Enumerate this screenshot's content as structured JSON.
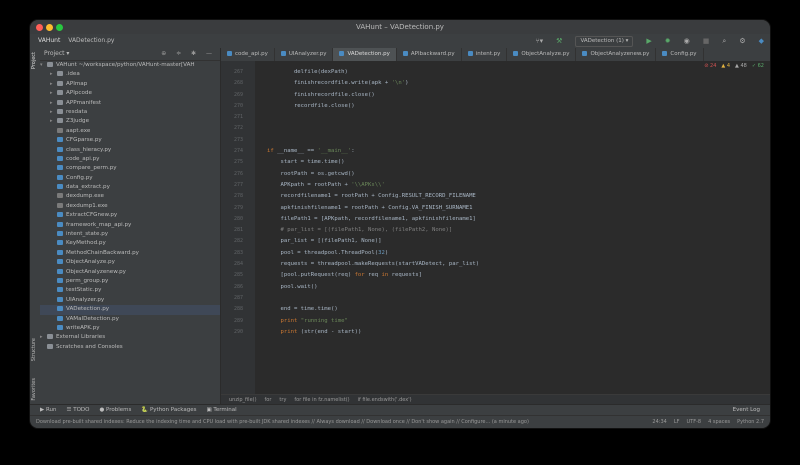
{
  "window": {
    "title": "VAHunt – VADetection.py",
    "colors": {
      "close": "#ff5f57",
      "minimize": "#febc2e",
      "maximize": "#28c840",
      "run_green": "#59a869"
    }
  },
  "navbar": {
    "project": "VAHunt",
    "file": "VADetection.py",
    "run_config": "VADetection (1) ▾",
    "icons": [
      "hammer-icon",
      "play-icon",
      "debug-icon",
      "coverage-icon",
      "stop-icon",
      "search-icon",
      "settings-icon"
    ]
  },
  "left_strip": {
    "project_tab": "Project",
    "structure_tab": "Structure",
    "favorites_tab": "Favorites"
  },
  "project_panel": {
    "header": "Project ▾",
    "root": "VAHunt ~/workspace/python/VAHunt-master[VAH",
    "items": [
      {
        "label": ".idea",
        "type": "folder",
        "indent": 1,
        "arrow": true
      },
      {
        "label": "APImap",
        "type": "folder",
        "indent": 1,
        "arrow": true
      },
      {
        "label": "APIpcode",
        "type": "folder",
        "indent": 1,
        "arrow": true
      },
      {
        "label": "APPmanifest",
        "type": "folder",
        "indent": 1,
        "arrow": true
      },
      {
        "label": "resdata",
        "type": "folder",
        "indent": 1,
        "arrow": true
      },
      {
        "label": "Z3judge",
        "type": "folder",
        "indent": 1,
        "arrow": true
      },
      {
        "label": "aapt.exe",
        "type": "exe",
        "indent": 1,
        "arrow": false
      },
      {
        "label": "CFGparse.py",
        "type": "py",
        "indent": 1,
        "arrow": false
      },
      {
        "label": "class_hieracy.py",
        "type": "py",
        "indent": 1,
        "arrow": false
      },
      {
        "label": "code_api.py",
        "type": "py",
        "indent": 1,
        "arrow": false
      },
      {
        "label": "compare_perm.py",
        "type": "py",
        "indent": 1,
        "arrow": false
      },
      {
        "label": "Config.py",
        "type": "py",
        "indent": 1,
        "arrow": false
      },
      {
        "label": "data_extract.py",
        "type": "py",
        "indent": 1,
        "arrow": false
      },
      {
        "label": "dexdump.exe",
        "type": "exe",
        "indent": 1,
        "arrow": false
      },
      {
        "label": "dexdump1.exe",
        "type": "exe",
        "indent": 1,
        "arrow": false
      },
      {
        "label": "ExtractCFGnew.py",
        "type": "py",
        "indent": 1,
        "arrow": false
      },
      {
        "label": "framework_map_api.py",
        "type": "py",
        "indent": 1,
        "arrow": false
      },
      {
        "label": "intent_state.py",
        "type": "py",
        "indent": 1,
        "arrow": false
      },
      {
        "label": "KeyMethod.py",
        "type": "py",
        "indent": 1,
        "arrow": false
      },
      {
        "label": "MethodChainBackward.py",
        "type": "py",
        "indent": 1,
        "arrow": false
      },
      {
        "label": "ObjectAnalyze.py",
        "type": "py",
        "indent": 1,
        "arrow": false
      },
      {
        "label": "ObjectAnalyzenew.py",
        "type": "py",
        "indent": 1,
        "arrow": false
      },
      {
        "label": "perm_group.py",
        "type": "py",
        "indent": 1,
        "arrow": false
      },
      {
        "label": "testStatic.py",
        "type": "py",
        "indent": 1,
        "arrow": false
      },
      {
        "label": "UIAnalyzer.py",
        "type": "py",
        "indent": 1,
        "arrow": false
      },
      {
        "label": "VADetection.py",
        "type": "py",
        "indent": 1,
        "arrow": false
      },
      {
        "label": "VAMalDetection.py",
        "type": "py",
        "indent": 1,
        "arrow": false
      },
      {
        "label": "writeAPK.py",
        "type": "py",
        "indent": 1,
        "arrow": false
      },
      {
        "label": "External Libraries",
        "type": "folder",
        "indent": 0,
        "arrow": true
      },
      {
        "label": "Scratches and Consoles",
        "type": "folder",
        "indent": 0,
        "arrow": false
      }
    ]
  },
  "tabs": [
    {
      "label": "code_api.py",
      "active": false
    },
    {
      "label": "UIAnalyzer.py",
      "active": false
    },
    {
      "label": "VADetection.py",
      "active": true
    },
    {
      "label": "APIbackward.py",
      "active": false
    },
    {
      "label": "intent.py",
      "active": false
    },
    {
      "label": "ObjectAnalyze.py",
      "active": false
    },
    {
      "label": "ObjectAnalyzenew.py",
      "active": false
    },
    {
      "label": "Config.py",
      "active": false
    }
  ],
  "inspections": {
    "errors": "24",
    "warnings": "4",
    "weak": "48",
    "typos": "62"
  },
  "code_lines": [
    {
      "n": "267",
      "html": "        delfile(dexPath)"
    },
    {
      "n": "268",
      "html": "        finishrecordfile.write(apk + <span class='str'>'\\n'</span>)"
    },
    {
      "n": "269",
      "html": "        finishrecordfile.close()"
    },
    {
      "n": "270",
      "html": "        recordfile.close()"
    },
    {
      "n": "271",
      "html": ""
    },
    {
      "n": "272",
      "html": ""
    },
    {
      "n": "273",
      "html": ""
    },
    {
      "n": "274",
      "html": "<span class='kw'>if</span> __name__ == <span class='str'>'__main__'</span>:"
    },
    {
      "n": "275",
      "html": "    start = time.time()"
    },
    {
      "n": "276",
      "html": "    rootPath = os.getcwd()"
    },
    {
      "n": "277",
      "html": "    APKpath = rootPath + <span class='str'>'\\\\APKs\\\\'</span>"
    },
    {
      "n": "278",
      "html": "    recordfilename1 = rootPath + Config.RESULT_RECORD_FILENAME"
    },
    {
      "n": "279",
      "html": "    apkfinishfilename1 = rootPath + Config.VA_FINISH_SURNAME1"
    },
    {
      "n": "280",
      "html": "    filePath1 = [APKpath, recordfilename1, apkfinishfilename1]"
    },
    {
      "n": "281",
      "html": "    <span class='cm'># par_list = [(filePath1, None), (filePath2, None)]</span>"
    },
    {
      "n": "282",
      "html": "    par_list = [(filePath1, None)]"
    },
    {
      "n": "283",
      "html": "    pool = threadpool.ThreadPool(<span class='num'>32</span>)"
    },
    {
      "n": "284",
      "html": "    requests = threadpool.makeRequests(startVADetect, par_list)"
    },
    {
      "n": "285",
      "html": "    [pool.putRequest(req) <span class='kw'>for</span> req <span class='kw'>in</span> requests]"
    },
    {
      "n": "286",
      "html": "    pool.wait()"
    },
    {
      "n": "287",
      "html": ""
    },
    {
      "n": "288",
      "html": "    end = time.time()"
    },
    {
      "n": "289",
      "html": "    <span class='kw'>print</span> <span class='str'>\"running time\"</span>"
    },
    {
      "n": "290",
      "html": "    <span class='kw'>print</span> (str(end - start))"
    }
  ],
  "breadcrumb": [
    "unzip_file()",
    "for",
    "try",
    "for file in fz.namelist()",
    "if file.endswith('.dex')"
  ],
  "bottom_tabs": [
    "▶ Run",
    "☰ TODO",
    "● Problems",
    "🐍 Python Packages",
    "▣ Terminal"
  ],
  "event_log": "Event Log",
  "status": {
    "message": "Download pre-built shared indexes: Reduce the indexing time and CPU load with pre-built JDK shared indexes // Always download // Download once // Don't show again // Configure... (a minute ago)",
    "position": "24:34",
    "line_sep": "LF",
    "encoding": "UTF-8",
    "indent": "4 spaces",
    "interpreter": "Python 2.7"
  }
}
